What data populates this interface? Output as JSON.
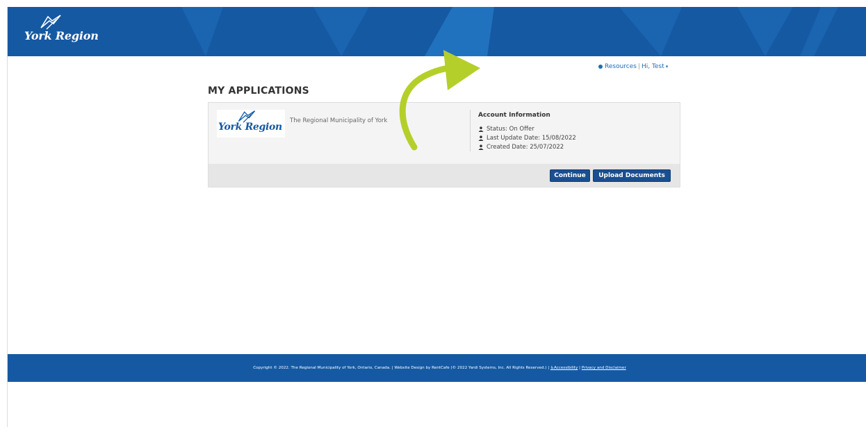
{
  "header": {
    "logo_text": "York Region",
    "logo_icon": "york-region-bird-icon",
    "brand_color": "#1559a3"
  },
  "user_nav": {
    "resources_label": "Resources",
    "separator": "|",
    "greeting": "Hi, Test",
    "caret": "▾"
  },
  "page": {
    "title": "MY APPLICATIONS"
  },
  "application": {
    "logo_text": "York Region",
    "org_name": "The Regional Municipality of York",
    "account_title": "Account Information",
    "status": "Status: On Offer",
    "last_update": "Last Update Date: 15/08/2022",
    "created": "Created Date: 25/07/2022",
    "continue_label": "Continue",
    "upload_label": "Upload Documents"
  },
  "annotation": {
    "arrow_color": "#b5cf2a"
  },
  "footer": {
    "copyright": "Copyright © 2022. The Regional Municipality of York, Ontario, Canada. | Website Design by RentCafe (© 2022 Yardi Systems, Inc. All Rights Reserved.) |",
    "accessibility_label": "Accessibility",
    "accessibility_icon": "♿",
    "separator": "|",
    "privacy_label": "Privacy and Disclaimer"
  }
}
